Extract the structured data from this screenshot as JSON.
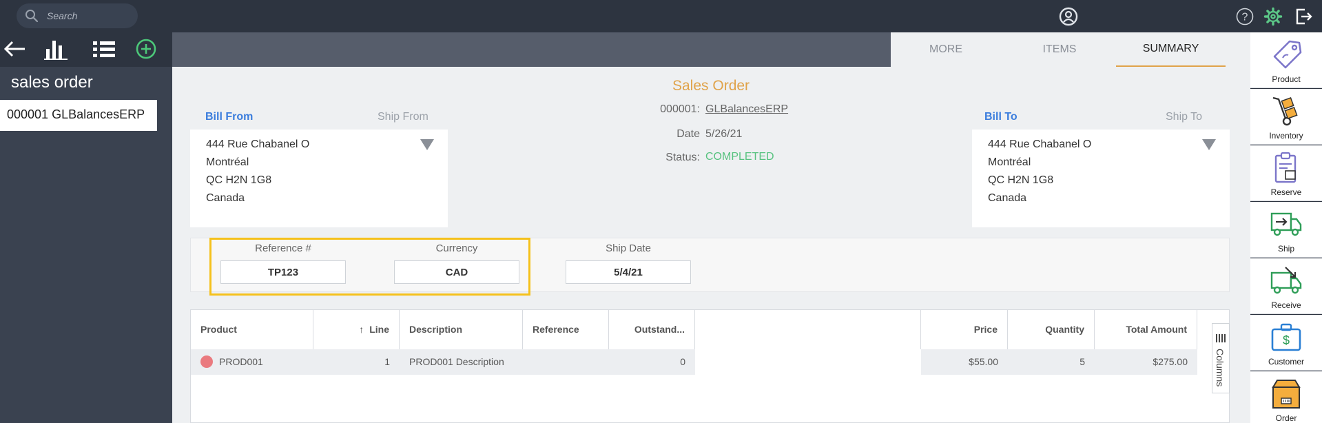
{
  "topbar": {
    "search_placeholder": "Search"
  },
  "sidebar": {
    "title": "sales order",
    "items": [
      {
        "label": "000001 GLBalancesERP"
      }
    ]
  },
  "tabs": [
    {
      "label": "MORE"
    },
    {
      "label": "ITEMS"
    },
    {
      "label": "SUMMARY",
      "active": true
    }
  ],
  "order": {
    "title": "Sales Order",
    "number_label": "000001:",
    "number_value": "GLBalancesERP",
    "date_label": "Date",
    "date_value": "5/26/21",
    "status_label": "Status:",
    "status_value": "COMPLETED"
  },
  "bill_from": {
    "tab_active": "Bill From",
    "tab_other": "Ship From",
    "lines": [
      "444 Rue Chabanel O",
      "Montréal",
      "QC H2N 1G8",
      "Canada"
    ]
  },
  "bill_to": {
    "tab_active": "Bill To",
    "tab_other": "Ship To",
    "lines": [
      "444 Rue Chabanel O",
      "Montréal",
      "QC H2N 1G8",
      "Canada"
    ]
  },
  "fields": {
    "reference_label": "Reference #",
    "reference_value": "TP123",
    "currency_label": "Currency",
    "currency_value": "CAD",
    "ship_date_label": "Ship Date",
    "ship_date_value": "5/4/21"
  },
  "table": {
    "headers": {
      "product": "Product",
      "line": "Line",
      "description": "Description",
      "reference": "Reference",
      "outstanding": "Outstand...",
      "price": "Price",
      "quantity": "Quantity",
      "total": "Total Amount"
    },
    "rows": [
      {
        "product": "PROD001",
        "line": "1",
        "description": "PROD001 Description",
        "reference": "",
        "outstanding": "0",
        "price": "$55.00",
        "quantity": "5",
        "total": "$275.00"
      }
    ],
    "columns_label": "Columns"
  },
  "rail": [
    {
      "label": "Product",
      "icon": "tag-icon"
    },
    {
      "label": "Inventory",
      "icon": "hand-truck-icon"
    },
    {
      "label": "Reserve",
      "icon": "clipboard-icon"
    },
    {
      "label": "Ship",
      "icon": "ship-truck-icon"
    },
    {
      "label": "Receive",
      "icon": "receive-truck-icon"
    },
    {
      "label": "Customer",
      "icon": "briefcase-icon"
    },
    {
      "label": "Order",
      "icon": "box-icon"
    }
  ],
  "colors": {
    "accent": "#e0a34a",
    "link_blue": "#3b7ddd",
    "status_green": "#57c27f",
    "highlight": "#f5c11b",
    "topbar": "#2d3440"
  }
}
